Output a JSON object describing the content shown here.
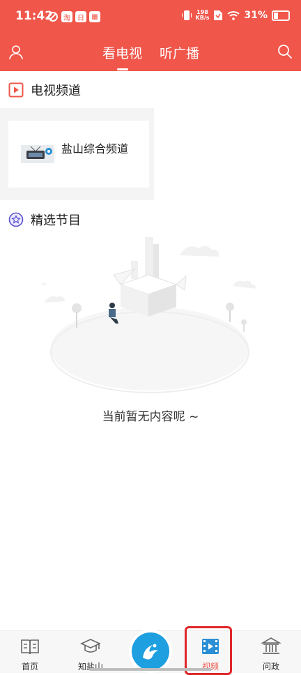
{
  "status_bar": {
    "time": "11:42",
    "net_speed_value": "198",
    "net_speed_unit": "KB/s",
    "battery": "31%"
  },
  "header": {
    "tabs": [
      {
        "label": "看电视",
        "active": true
      },
      {
        "label": "听广播",
        "active": false
      }
    ],
    "user_icon": "user-icon",
    "search_icon": "search-icon"
  },
  "tv_section": {
    "title": "电视频道",
    "icon": "play-square-icon",
    "channels": [
      {
        "name": "盐山综合频道"
      }
    ]
  },
  "featured_section": {
    "title": "精选节目",
    "icon": "star-badge-icon",
    "empty_text": "当前暂无内容呢 ~"
  },
  "bottom_nav": {
    "items": [
      {
        "label": "首页",
        "icon": "book-icon"
      },
      {
        "label": "知盐山",
        "icon": "graduation-cap-icon"
      },
      {
        "label": "",
        "icon": "app-logo-icon"
      },
      {
        "label": "视频",
        "icon": "film-icon",
        "active": true
      },
      {
        "label": "问政",
        "icon": "government-building-icon"
      }
    ]
  },
  "colors": {
    "accent": "#f0564a",
    "center_button": "#1e9fe0",
    "highlight_box": "#e0262a"
  }
}
